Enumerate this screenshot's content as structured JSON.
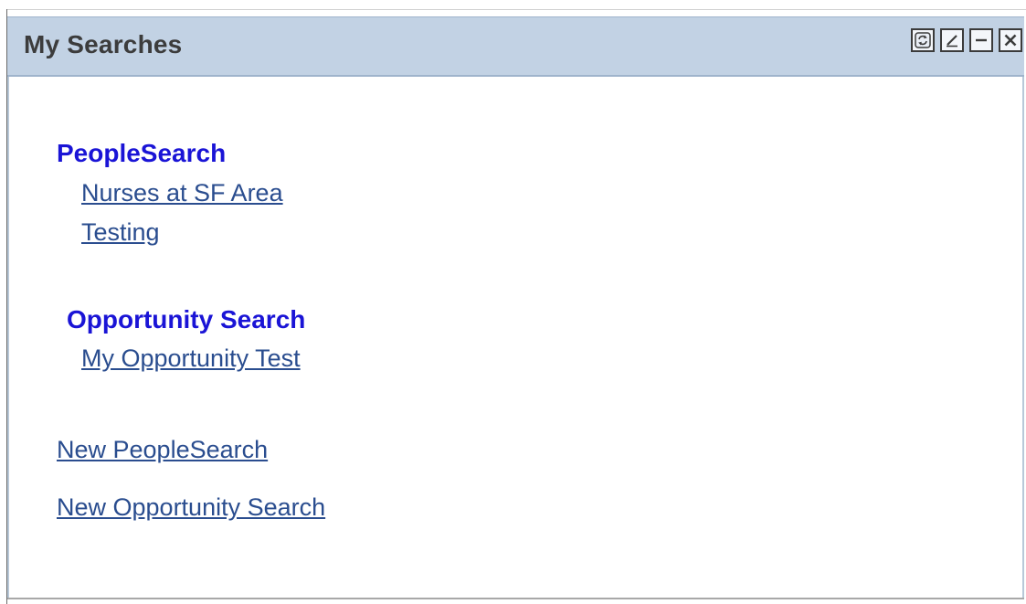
{
  "pagelet": {
    "title": "My Searches",
    "tools": {
      "refresh_icon": "refresh-icon",
      "edit_icon": "edit-icon",
      "minimize_icon": "minimize-icon",
      "close_icon": "close-icon"
    }
  },
  "groups": [
    {
      "heading": "PeopleSearch",
      "links": [
        "Nurses at SF Area",
        "Testing"
      ]
    },
    {
      "heading": "Opportunity Search",
      "links": [
        "My Opportunity Test"
      ]
    }
  ],
  "actions": {
    "new_people_search": "New PeopleSearch",
    "new_opportunity_search": "New Opportunity Search"
  },
  "colors": {
    "header_bg": "#c2d2e4",
    "heading_blue": "#1a14d6",
    "link_blue": "#2a4d8f"
  }
}
